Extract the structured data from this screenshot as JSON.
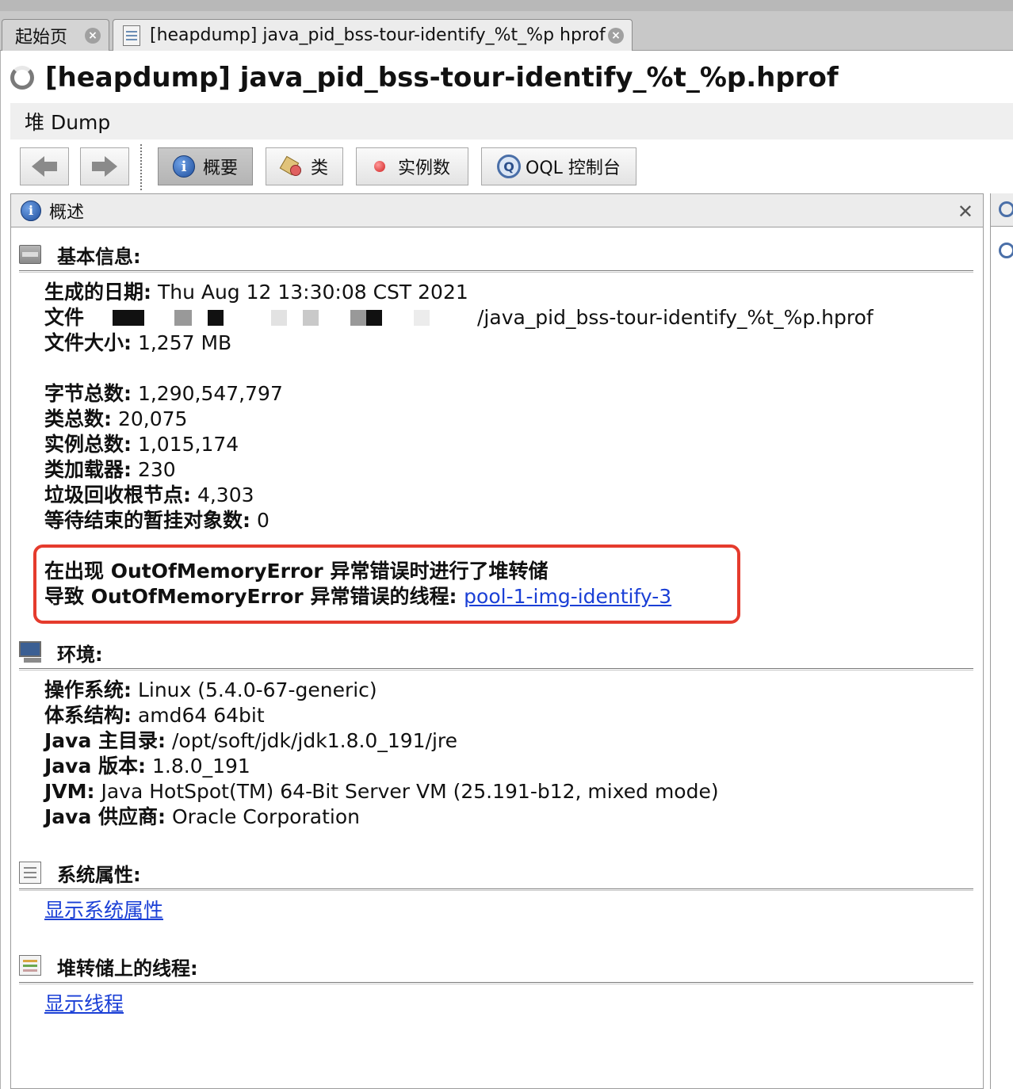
{
  "tabs": [
    {
      "label": "起始页"
    },
    {
      "label": "[heapdump] java_pid_bss-tour-identify_%t_%p hprof"
    }
  ],
  "heading": "[heapdump] java_pid_bss-tour-identify_%t_%p.hprof",
  "subbar": "堆 Dump",
  "toolbar": {
    "overview": "概要",
    "classes": "类",
    "instances": "实例数",
    "oql": "OQL 控制台"
  },
  "panel": {
    "title": "概述"
  },
  "basic": {
    "title": "基本信息:",
    "date_label": "生成的日期:",
    "date_value": " Thu Aug 12 13:30:08 CST 2021",
    "file_label": "文件",
    "file_value": "/java_pid_bss-tour-identify_%t_%p.hprof",
    "size_label": "文件大小:",
    "size_value": " 1,257 MB",
    "bytes_label": "字节总数:",
    "bytes_value": " 1,290,547,797",
    "classes_label": "类总数:",
    "classes_value": " 20,075",
    "instances_label": "实例总数:",
    "instances_value": " 1,015,174",
    "loaders_label": "类加载器:",
    "loaders_value": " 230",
    "gcroots_label": "垃圾回收根节点:",
    "gcroots_value": " 4,303",
    "pending_label": "等待结束的暂挂对象数:",
    "pending_value": " 0",
    "oom_line": "在出现 OutOfMemoryError 异常错误时进行了堆转储",
    "oom_thread_label": "导致 OutOfMemoryError 异常错误的线程: ",
    "oom_thread_link": "pool-1-img-identify-3"
  },
  "env": {
    "title": "环境:",
    "os_label": "操作系统:",
    "os_value": " Linux (5.4.0-67-generic)",
    "arch_label": "体系结构:",
    "arch_value": " amd64 64bit",
    "home_label": "Java 主目录:",
    "home_value": " /opt/soft/jdk/jdk1.8.0_191/jre",
    "version_label": "Java 版本:",
    "version_value": " 1.8.0_191",
    "jvm_label": "JVM:",
    "jvm_value": " Java HotSpot(TM) 64-Bit Server VM (25.191-b12, mixed mode)",
    "vendor_label": "Java 供应商:",
    "vendor_value": " Oracle Corporation"
  },
  "sysprops": {
    "title": "系统属性:",
    "link": "显示系统属性"
  },
  "threads": {
    "title": "堆转储上的线程:",
    "link": "显示线程"
  },
  "colors": {
    "highlight": "#e53b2d",
    "link": "#1a3fd6"
  }
}
